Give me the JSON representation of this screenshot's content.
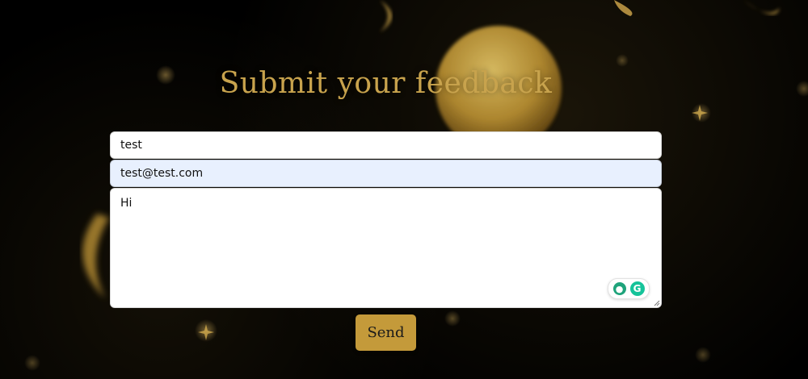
{
  "page": {
    "title": "Submit your feedback"
  },
  "form": {
    "name_value": "test",
    "email_value": "test@test.com",
    "message_value": "Hi",
    "send_label": "Send"
  },
  "assist_widget": {
    "primary_icon": "lightbulb-icon",
    "brand_icon": "grammarly-icon",
    "brand_letter": "G"
  },
  "colors": {
    "accent_gold": "#c49a3a",
    "title_gold": "#c8a34d",
    "autofill_blue": "#e8f0fe",
    "background": "#000000"
  }
}
